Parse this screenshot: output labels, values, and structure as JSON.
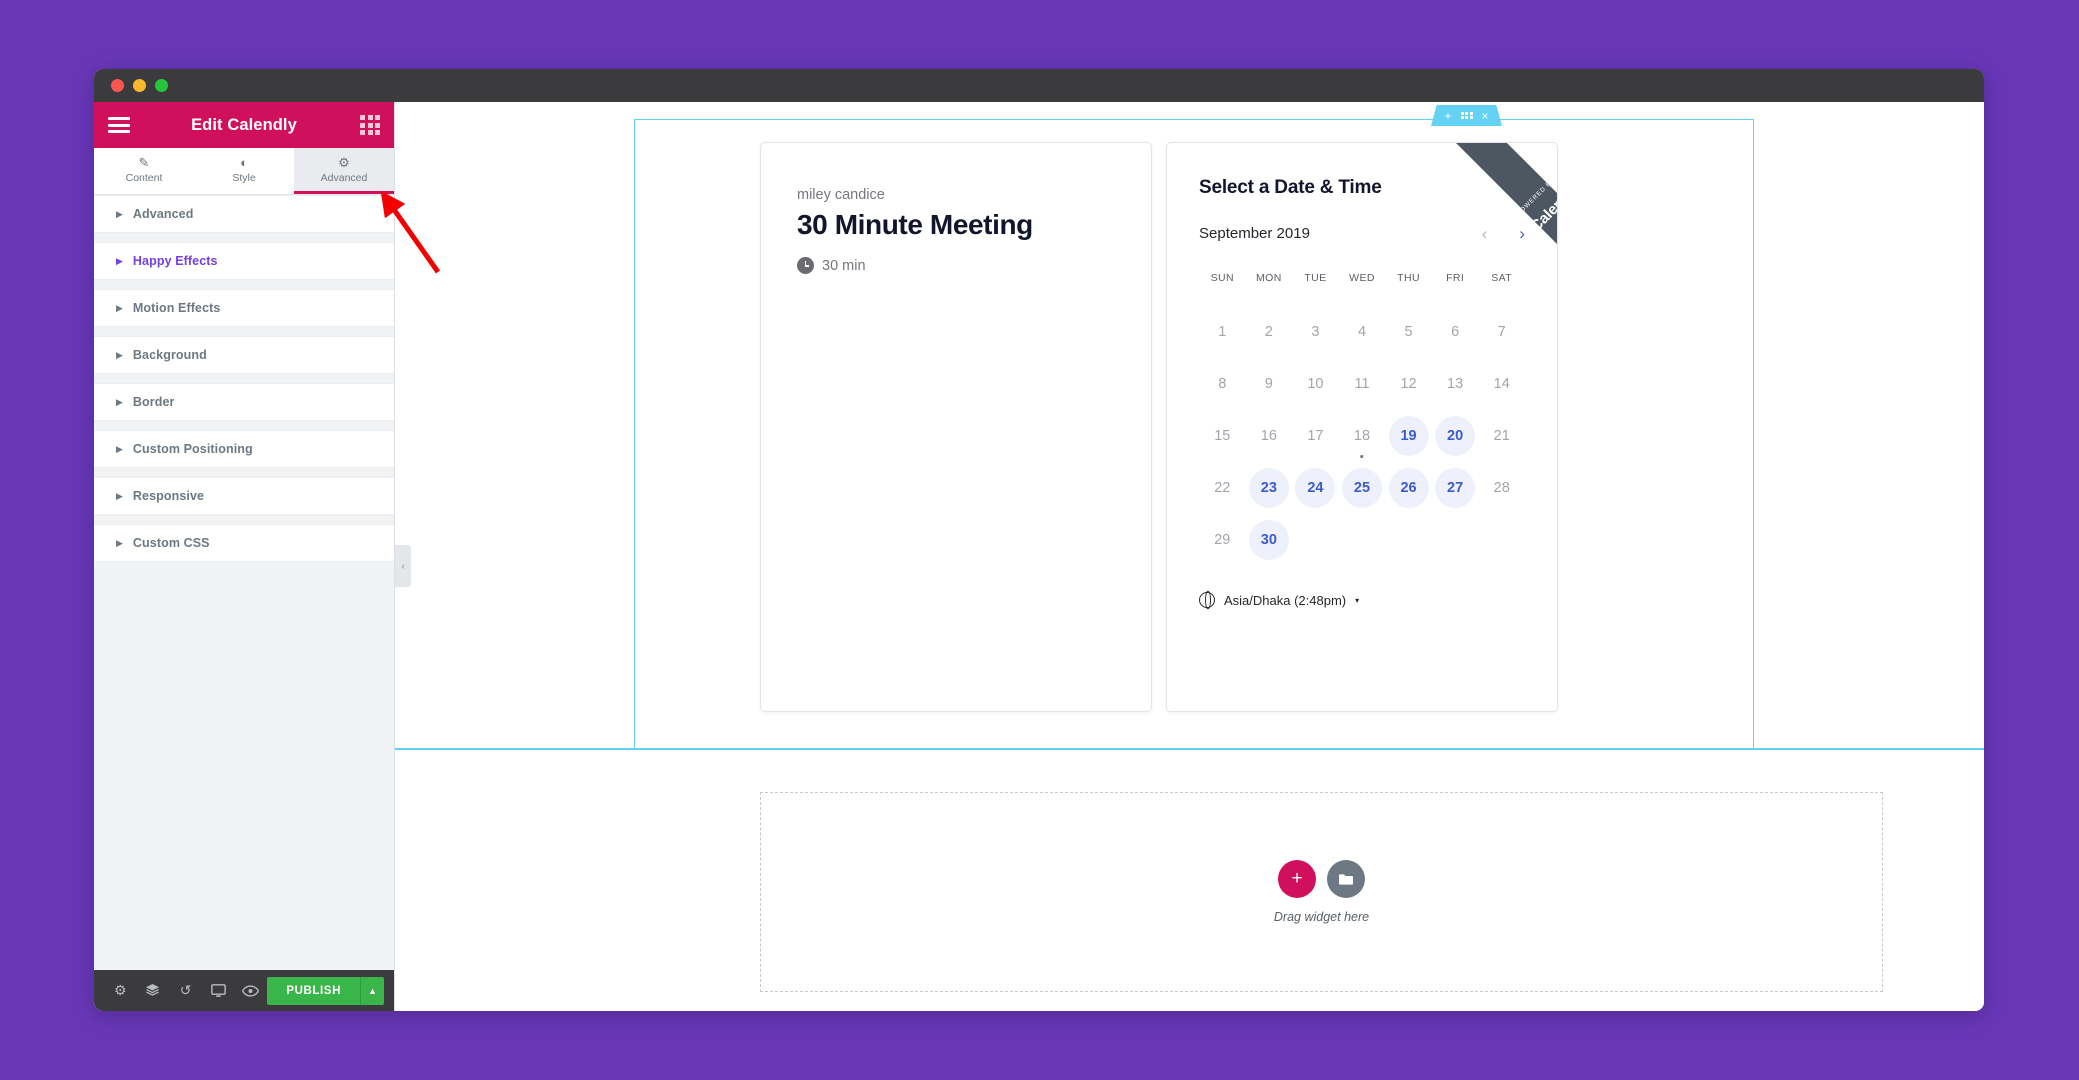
{
  "window": {
    "traffic_lights": [
      "close",
      "minimize",
      "maximize"
    ]
  },
  "panel": {
    "title": "Edit Calendly",
    "menu_icon": "hamburger-icon",
    "grid_icon": "grid-icon",
    "tabs": [
      {
        "label": "Content",
        "icon": "pencil-icon",
        "active": false
      },
      {
        "label": "Style",
        "icon": "contrast-icon",
        "active": false
      },
      {
        "label": "Advanced",
        "icon": "gear-icon",
        "active": true
      }
    ],
    "sections": [
      {
        "label": "Advanced",
        "highlight": false
      },
      {
        "label": "Happy Effects",
        "highlight": true
      },
      {
        "label": "Motion Effects",
        "highlight": false
      },
      {
        "label": "Background",
        "highlight": false
      },
      {
        "label": "Border",
        "highlight": false
      },
      {
        "label": "Custom Positioning",
        "highlight": false
      },
      {
        "label": "Responsive",
        "highlight": false
      },
      {
        "label": "Custom CSS",
        "highlight": false
      }
    ],
    "footer": {
      "buttons": [
        {
          "icon": "gear-icon",
          "name": "settings-button"
        },
        {
          "icon": "layers-icon",
          "name": "navigator-button"
        },
        {
          "icon": "history-icon",
          "name": "history-button"
        },
        {
          "icon": "monitor-icon",
          "name": "responsive-mode-button"
        },
        {
          "icon": "eye-icon",
          "name": "preview-button"
        }
      ],
      "publish_label": "PUBLISH",
      "publish_caret": "▲"
    }
  },
  "canvas": {
    "collapse_handle": "‹",
    "section_handle": {
      "add_icon": "+",
      "drag_icon": "drag-dots-icon",
      "close_icon": "×"
    },
    "calendly": {
      "host_name": "miley candice",
      "event_title": "30 Minute Meeting",
      "duration": "30 min",
      "duration_icon": "clock-icon",
      "heading": "Select a Date & Time",
      "month": "September 2019",
      "prev_icon": "‹",
      "next_icon": "›",
      "ribbon_powered": "POWERED BY",
      "ribbon_brand": "Calendly",
      "day_headers": [
        "SUN",
        "MON",
        "TUE",
        "WED",
        "THU",
        "FRI",
        "SAT"
      ],
      "weeks": [
        [
          {
            "d": "1",
            "avail": false
          },
          {
            "d": "2",
            "avail": false
          },
          {
            "d": "3",
            "avail": false
          },
          {
            "d": "4",
            "avail": false
          },
          {
            "d": "5",
            "avail": false
          },
          {
            "d": "6",
            "avail": false
          },
          {
            "d": "7",
            "avail": false
          }
        ],
        [
          {
            "d": "8",
            "avail": false
          },
          {
            "d": "9",
            "avail": false
          },
          {
            "d": "10",
            "avail": false
          },
          {
            "d": "11",
            "avail": false
          },
          {
            "d": "12",
            "avail": false
          },
          {
            "d": "13",
            "avail": false
          },
          {
            "d": "14",
            "avail": false
          }
        ],
        [
          {
            "d": "15",
            "avail": false
          },
          {
            "d": "16",
            "avail": false
          },
          {
            "d": "17",
            "avail": false
          },
          {
            "d": "18",
            "avail": false,
            "today": true
          },
          {
            "d": "19",
            "avail": true
          },
          {
            "d": "20",
            "avail": true
          },
          {
            "d": "21",
            "avail": false
          }
        ],
        [
          {
            "d": "22",
            "avail": false
          },
          {
            "d": "23",
            "avail": true
          },
          {
            "d": "24",
            "avail": true
          },
          {
            "d": "25",
            "avail": true
          },
          {
            "d": "26",
            "avail": true
          },
          {
            "d": "27",
            "avail": true
          },
          {
            "d": "28",
            "avail": false
          }
        ],
        [
          {
            "d": "29",
            "avail": false
          },
          {
            "d": "30",
            "avail": true
          },
          {
            "d": "",
            "avail": false
          },
          {
            "d": "",
            "avail": false
          },
          {
            "d": "",
            "avail": false
          },
          {
            "d": "",
            "avail": false
          },
          {
            "d": "",
            "avail": false
          }
        ]
      ],
      "timezone": "Asia/Dhaka (2:48pm)",
      "timezone_icon": "globe-icon",
      "timezone_caret": "▾"
    },
    "dropzone": {
      "add_icon": "+",
      "folder_icon": "folder-icon",
      "label": "Drag widget here"
    }
  },
  "colors": {
    "desktop_bg": "#6837b8",
    "panel_header": "#d0105c",
    "accent_purple": "#7441e0",
    "publish_green": "#39b54a",
    "section_blue": "#63d2f4",
    "calendly_blue": "#3c5bd1",
    "ribbon_gray": "#4d5761"
  }
}
